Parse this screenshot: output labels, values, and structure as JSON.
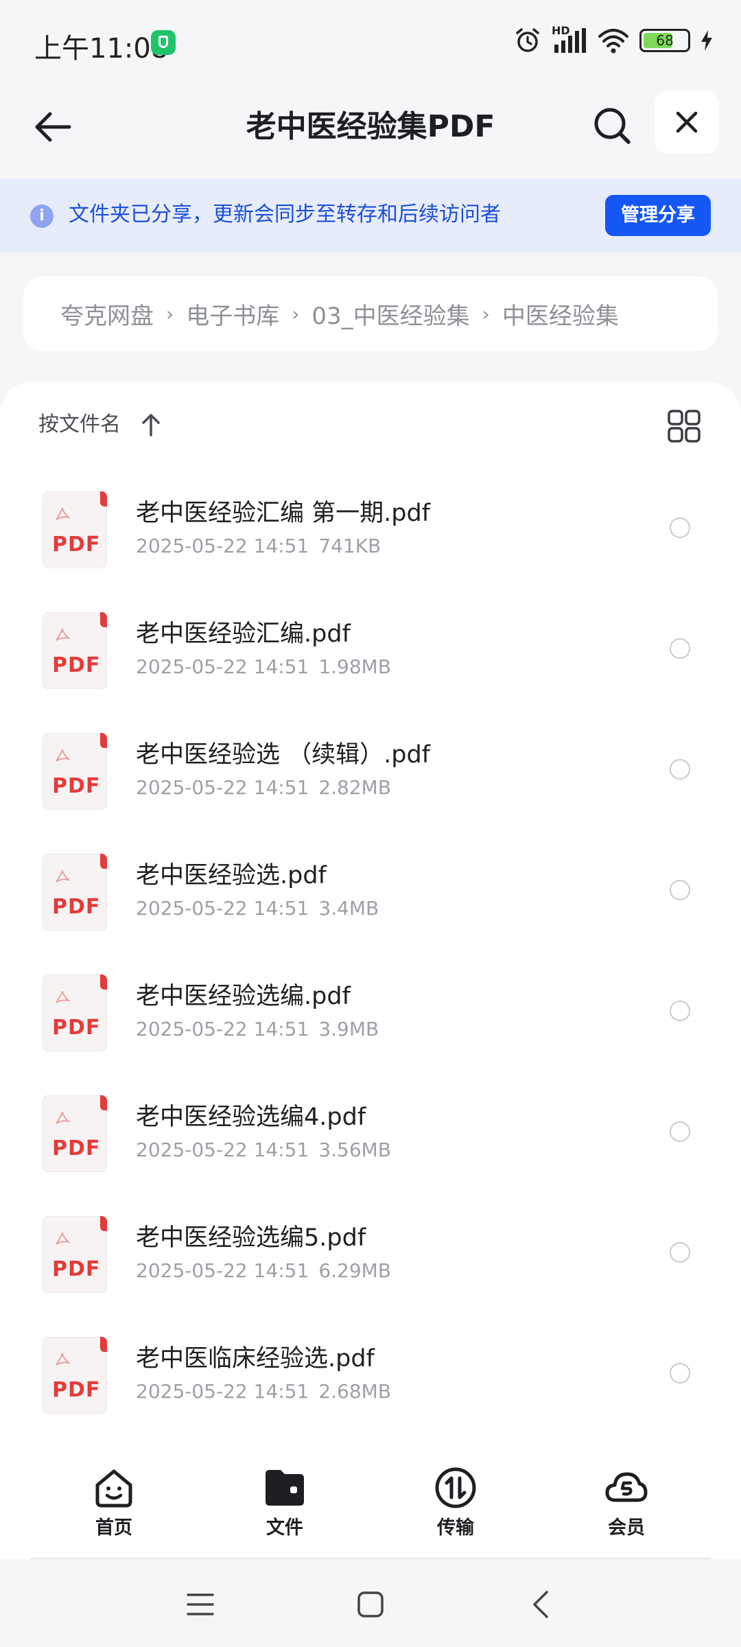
{
  "status_bar": {
    "time": "上午11:08",
    "network_label": "HD",
    "battery_level": "68",
    "battery_fraction": 0.68
  },
  "header": {
    "title": "老中医经验集PDF",
    "icons": {
      "back": "arrow-left-icon",
      "search": "search-icon",
      "close": "close-icon"
    }
  },
  "share_banner": {
    "text": "文件夹已分享，更新会同步至转存和后续访问者",
    "button_label": "管理分享",
    "icon": "info-icon"
  },
  "breadcrumb": {
    "items": [
      "夸克网盘",
      "电子书库",
      "03_中医经验集",
      "中医经验集"
    ],
    "separator": "›"
  },
  "sort": {
    "label": "按文件名",
    "direction": "ascending",
    "view_toggle_icon": "grid-view-icon"
  },
  "files": [
    {
      "name": "老中医经验汇编 第一期.pdf",
      "date": "2025-05-22 14:51",
      "size": "741KB",
      "type_label": "PDF"
    },
    {
      "name": "老中医经验汇编.pdf",
      "date": "2025-05-22 14:51",
      "size": "1.98MB",
      "type_label": "PDF"
    },
    {
      "name": "老中医经验选 （续辑）.pdf",
      "date": "2025-05-22 14:51",
      "size": "2.82MB",
      "type_label": "PDF"
    },
    {
      "name": "老中医经验选.pdf",
      "date": "2025-05-22 14:51",
      "size": "3.4MB",
      "type_label": "PDF"
    },
    {
      "name": "老中医经验选编.pdf",
      "date": "2025-05-22 14:51",
      "size": "3.9MB",
      "type_label": "PDF"
    },
    {
      "name": "老中医经验选编4.pdf",
      "date": "2025-05-22 14:51",
      "size": "3.56MB",
      "type_label": "PDF"
    },
    {
      "name": "老中医经验选编5.pdf",
      "date": "2025-05-22 14:51",
      "size": "6.29MB",
      "type_label": "PDF"
    },
    {
      "name": "老中医临床经验选.pdf",
      "date": "2025-05-22 14:51",
      "size": "2.68MB",
      "type_label": "PDF"
    }
  ],
  "bottom_nav": {
    "items": [
      {
        "label": "首页",
        "icon": "home-smile-icon"
      },
      {
        "label": "文件",
        "icon": "folder-icon",
        "active": true
      },
      {
        "label": "传输",
        "icon": "transfer-icon"
      },
      {
        "label": "会员",
        "icon": "vip-cloud-icon"
      }
    ]
  },
  "system_nav": {
    "icons": [
      "menu-icon",
      "home-square-icon",
      "back-chevron-icon"
    ]
  },
  "colors": {
    "accent": "#1457f5",
    "banner_bg": "#e7ecfb",
    "banner_text": "#1d4fd8",
    "pdf_red": "#e33b3b",
    "meta_gray": "#9da0a6"
  }
}
